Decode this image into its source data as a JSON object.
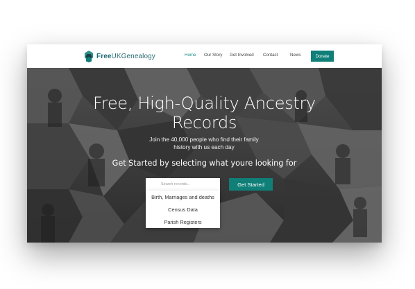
{
  "header": {
    "logo_bold": "Free",
    "logo_rest": "UKGenealogy",
    "nav": [
      {
        "label": "Home",
        "active": true
      },
      {
        "label": "Our Story",
        "active": false
      },
      {
        "label": "Get Involved",
        "active": false
      },
      {
        "label": "Contact",
        "active": false
      },
      {
        "label": "News",
        "active": false
      }
    ],
    "donate_label": "Donate"
  },
  "hero": {
    "headline_line1": "Free, High-Quality Ancestry",
    "headline_line2": "Records",
    "subtext_line1": "Join the 40,000 people who find their family",
    "subtext_line2": "history with us each day",
    "prompt": "Get Started by selecting what youre looking for",
    "search_placeholder": "Search records...",
    "search_button_label": "Get Started",
    "dropdown_options": [
      "Birth, Marriages and deaths",
      "Census Data",
      "Parish Registers"
    ]
  },
  "colors": {
    "accent": "#0f7f78",
    "nav_active": "#1c8a86",
    "logo": "#1d6b72"
  }
}
